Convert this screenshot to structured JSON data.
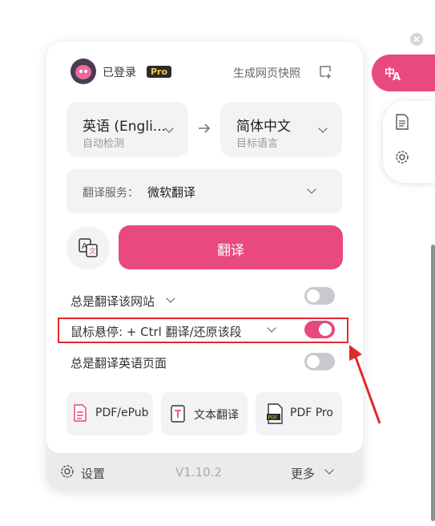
{
  "header": {
    "login_status": "已登录",
    "pro_badge": "Pro",
    "snapshot_label": "生成网页快照"
  },
  "languages": {
    "source_name": "英语 (Engli...",
    "source_sub": "自动检测",
    "target_name": "简体中文",
    "target_sub": "目标语言"
  },
  "service": {
    "label": "翻译服务：",
    "value": "微软翻译"
  },
  "translate_button": "翻译",
  "options": [
    {
      "label": "总是翻译该网站",
      "enabled": false
    },
    {
      "label": "鼠标悬停:  + Ctrl 翻译/还原该段",
      "enabled": true
    },
    {
      "label": "总是翻译英语页面",
      "enabled": false
    }
  ],
  "tools": [
    {
      "label": "PDF/ePub",
      "icon": "pdf-epub-icon"
    },
    {
      "label": "文本翻译",
      "icon": "text-translate-icon"
    },
    {
      "label": "PDF Pro",
      "icon": "pdf-pro-icon"
    }
  ],
  "footer": {
    "settings_label": "设置",
    "version": "V1.10.2",
    "more_label": "更多"
  },
  "colors": {
    "accent": "#e8497f",
    "highlight_box": "#e0282e",
    "card_bg": "#f3f3f5",
    "footer_bg": "#ebebee"
  }
}
